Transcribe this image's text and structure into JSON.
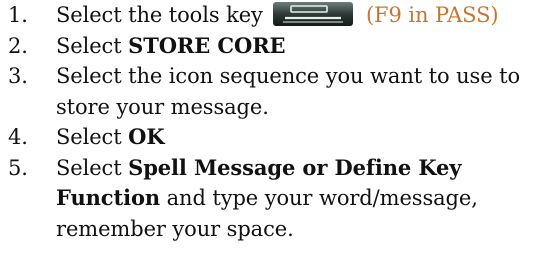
{
  "steps": [
    {
      "number": "1.",
      "before_icon": "Select the tools key",
      "icon": "tools-key-icon",
      "after_icon": "(F9 in PASS)",
      "after_icon_color": "#c8762e"
    },
    {
      "number": "2.",
      "prefix": "Select",
      "bold": "STORE CORE"
    },
    {
      "number": "3.",
      "text_line1": "Select the icon sequence you want to use to",
      "text_line2": "store your message."
    },
    {
      "number": "4.",
      "prefix": "Select",
      "bold": "OK"
    },
    {
      "number": "5.",
      "prefix": "Select",
      "bold_line1": "Spell Message or Define Key",
      "bold_line2": "Function",
      "rest_line2": "and type your word/message,",
      "line3": "remember your space."
    }
  ]
}
